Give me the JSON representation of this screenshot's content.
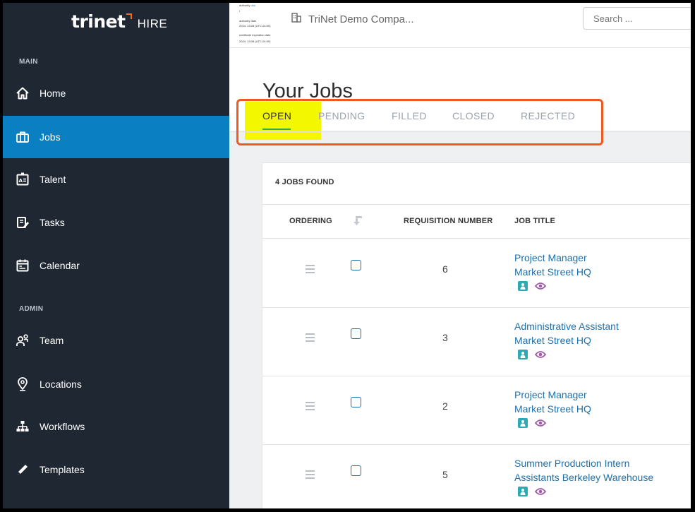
{
  "brand": {
    "name": "trinet",
    "product": "HIRE",
    "accent": "#f26b21"
  },
  "sidebar": {
    "bg": "#1f2733",
    "active_bg": "#0a7fc2",
    "main_label": "MAIN",
    "admin_label": "ADMIN",
    "items": [
      {
        "label": "Home",
        "icon": "home-icon"
      },
      {
        "label": "Jobs",
        "icon": "briefcase-icon",
        "active": true
      },
      {
        "label": "Talent",
        "icon": "id-card-icon"
      },
      {
        "label": "Tasks",
        "icon": "tasks-icon"
      },
      {
        "label": "Calendar",
        "icon": "calendar-icon"
      },
      {
        "label": "Team",
        "icon": "team-icon"
      },
      {
        "label": "Locations",
        "icon": "location-pin-icon"
      },
      {
        "label": "Workflows",
        "icon": "workflow-icon"
      },
      {
        "label": "Templates",
        "icon": "pencil-icon"
      }
    ]
  },
  "topbar": {
    "tiny_lines": [
      [
        "authority",
        "usu"
      ],
      [
        "i",
        ""
      ],
      [
        "authority date",
        ""
      ],
      [
        "2024, 13:08 (UTC-04:00)",
        ""
      ],
      [
        "certificate expiration date",
        ""
      ],
      [
        "2024, 13:08 (UTC-04:00)",
        ""
      ]
    ],
    "company": "TriNet Demo Compa...",
    "search_placeholder": "Search ..."
  },
  "page": {
    "title": "Your Jobs",
    "tabs": [
      "OPEN",
      "PENDING",
      "FILLED",
      "CLOSED",
      "REJECTED"
    ],
    "active_tab": "OPEN"
  },
  "table": {
    "found": "4 JOBS FOUND",
    "headers": {
      "ordering": "ORDERING",
      "requisition": "REQUISITION NUMBER",
      "title": "JOB TITLE"
    },
    "rows": [
      {
        "req": "6",
        "title": "Project Manager",
        "location": "Market Street HQ"
      },
      {
        "req": "3",
        "title": "Administrative Assistant",
        "location": "Market Street HQ"
      },
      {
        "req": "2",
        "title": "Project Manager",
        "location": "Market Street HQ"
      },
      {
        "req": "5",
        "title": "Summer Production Intern",
        "location": "Assistants Berkeley Warehouse"
      }
    ]
  },
  "colors": {
    "link": "#1f6fa8",
    "tab_active_underline": "#35a853",
    "annotation_box": "#ee5a1f",
    "highlight": "#f3f700",
    "badge": "#2fa9b3",
    "eye": "#a05aa8"
  }
}
